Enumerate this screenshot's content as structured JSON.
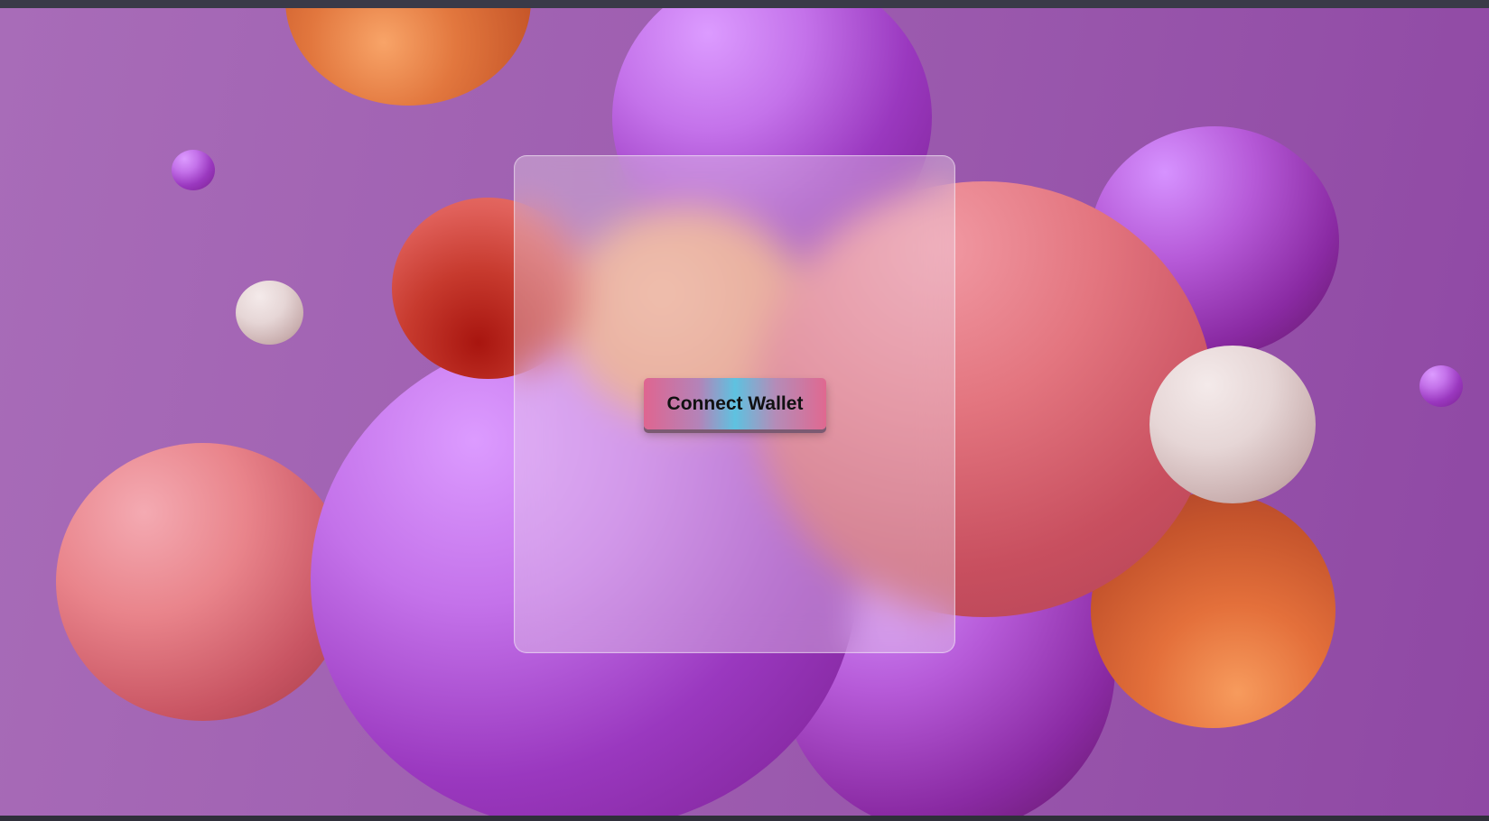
{
  "connect_button": {
    "label": "Connect Wallet"
  },
  "colors": {
    "background": "#9e5eb0",
    "button_gradient_start": "#df6590",
    "button_gradient_middle": "#5ec2e0",
    "button_gradient_end": "#e06890"
  }
}
